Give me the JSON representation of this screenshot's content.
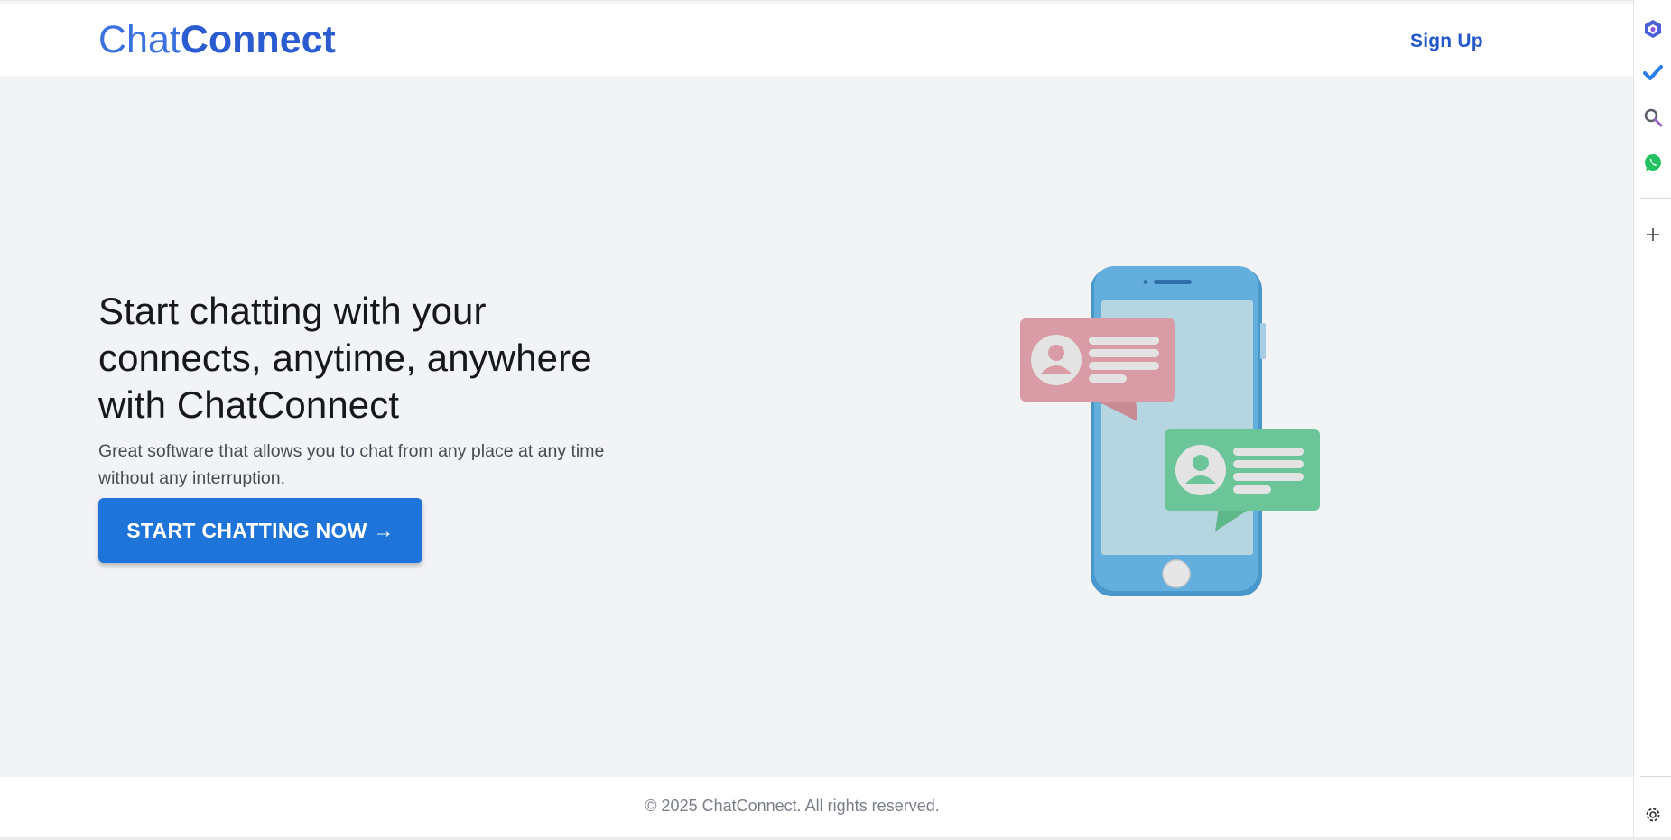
{
  "brand": {
    "part1": "Chat",
    "part2": "Connect"
  },
  "nav": {
    "signup_label": "Sign Up"
  },
  "hero": {
    "heading_line1": "Start chatting with your",
    "heading_line2": "connects, anytime, anywhere",
    "heading_line3": "with ChatConnect",
    "subtext": "Great software that allows you to chat from any place at any time without any interruption.",
    "cta_label": "START CHATTING NOW →"
  },
  "footer": {
    "copyright": "© 2025 ChatConnect. All rights reserved."
  },
  "sidebar": {
    "icons": [
      "copilot-icon",
      "todo-check-icon",
      "search-icon",
      "whatsapp-icon",
      "add-icon",
      "settings-icon"
    ]
  },
  "colors": {
    "accent": "#1e74d8",
    "brand": "#2a5bd0",
    "background": "#f2f3f5"
  }
}
